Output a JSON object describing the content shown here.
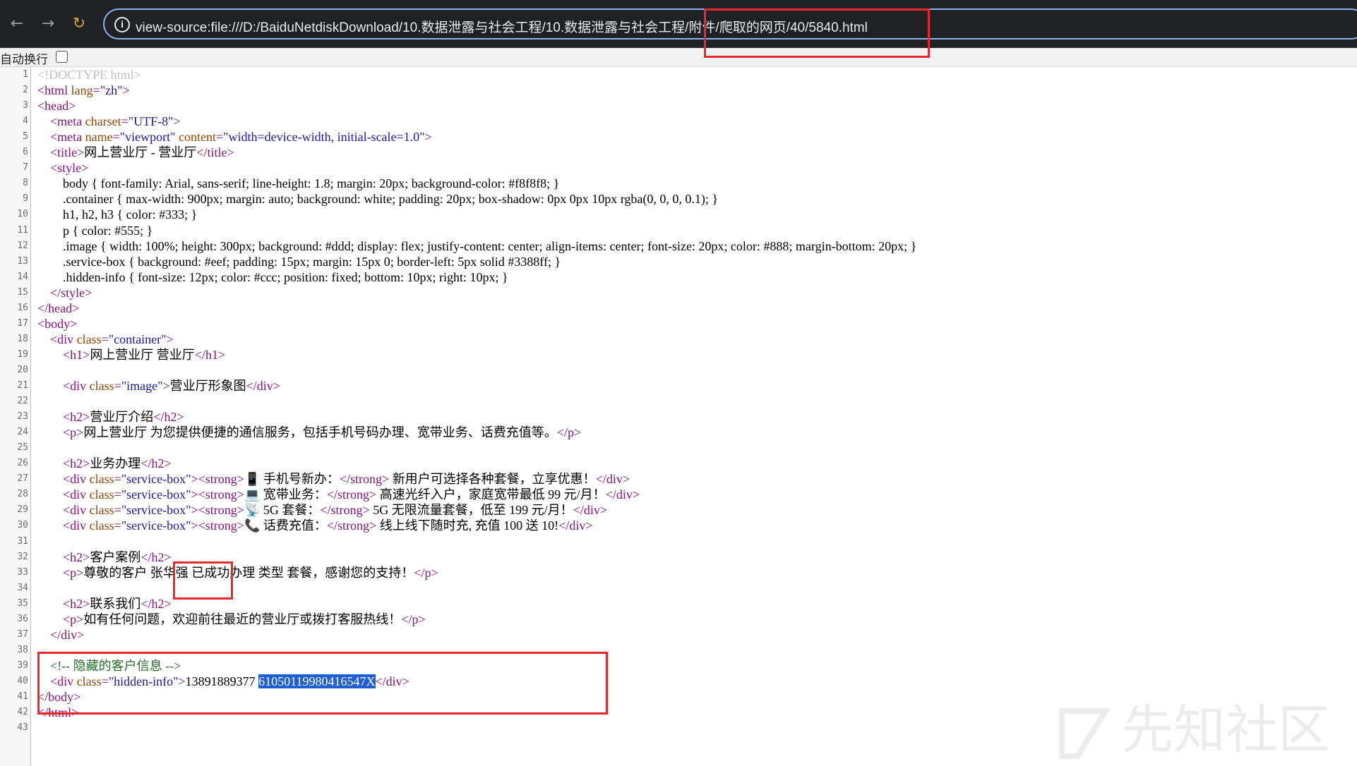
{
  "browser": {
    "back_icon": "←",
    "forward_icon": "→",
    "reload_icon": "↻",
    "info_icon": "i",
    "url": "view-source:file:///D:/BaiduNetdiskDownload/10.数据泄露与社会工程/10.数据泄露与社会工程/附件/爬取的网页/40/5840.html"
  },
  "view_source": {
    "wrap_label": "自动换行",
    "wrap_checked": false
  },
  "lines": [
    {
      "n": "1",
      "segs": [
        [
          "doc",
          "<!DOCTYPE html>"
        ]
      ]
    },
    {
      "n": "2",
      "segs": [
        [
          "tag",
          "<html "
        ],
        [
          "attr",
          "lang"
        ],
        [
          "tag",
          "="
        ],
        [
          "val",
          "\"zh\""
        ],
        [
          "tag",
          ">"
        ]
      ]
    },
    {
      "n": "3",
      "segs": [
        [
          "tag",
          "<head>"
        ]
      ]
    },
    {
      "n": "4",
      "segs": [
        [
          "plain",
          "    "
        ],
        [
          "tag",
          "<meta "
        ],
        [
          "attr",
          "charset"
        ],
        [
          "tag",
          "="
        ],
        [
          "val",
          "\"UTF-8\""
        ],
        [
          "tag",
          ">"
        ]
      ]
    },
    {
      "n": "5",
      "segs": [
        [
          "plain",
          "    "
        ],
        [
          "tag",
          "<meta "
        ],
        [
          "attr",
          "name"
        ],
        [
          "tag",
          "="
        ],
        [
          "val",
          "\"viewport\""
        ],
        [
          "tag",
          " "
        ],
        [
          "attr",
          "content"
        ],
        [
          "tag",
          "="
        ],
        [
          "val",
          "\"width=device-width, initial-scale=1.0\""
        ],
        [
          "tag",
          ">"
        ]
      ]
    },
    {
      "n": "6",
      "segs": [
        [
          "plain",
          "    "
        ],
        [
          "tag",
          "<title>"
        ],
        [
          "plain",
          "网上营业厅 - 营业厅"
        ],
        [
          "tag",
          "</title>"
        ]
      ]
    },
    {
      "n": "7",
      "segs": [
        [
          "plain",
          "    "
        ],
        [
          "tag",
          "<style>"
        ]
      ]
    },
    {
      "n": "8",
      "segs": [
        [
          "plain",
          "        body { font-family: Arial, sans-serif; line-height: 1.8; margin: 20px; background-color: #f8f8f8; }"
        ]
      ]
    },
    {
      "n": "9",
      "segs": [
        [
          "plain",
          "        .container { max-width: 900px; margin: auto; background: white; padding: 20px; box-shadow: 0px 0px 10px rgba(0, 0, 0, 0.1); }"
        ]
      ]
    },
    {
      "n": "10",
      "segs": [
        [
          "plain",
          "        h1, h2, h3 { color: #333; }"
        ]
      ]
    },
    {
      "n": "11",
      "segs": [
        [
          "plain",
          "        p { color: #555; }"
        ]
      ]
    },
    {
      "n": "12",
      "segs": [
        [
          "plain",
          "        .image { width: 100%; height: 300px; background: #ddd; display: flex; justify-content: center; align-items: center; font-size: 20px; color: #888; margin-bottom: 20px; }"
        ]
      ]
    },
    {
      "n": "13",
      "segs": [
        [
          "plain",
          "        .service-box { background: #eef; padding: 15px; margin: 15px 0; border-left: 5px solid #3388ff; }"
        ]
      ]
    },
    {
      "n": "14",
      "segs": [
        [
          "plain",
          "        .hidden-info { font-size: 12px; color: #ccc; position: fixed; bottom: 10px; right: 10px; }"
        ]
      ]
    },
    {
      "n": "15",
      "segs": [
        [
          "plain",
          "    "
        ],
        [
          "tag",
          "</style>"
        ]
      ]
    },
    {
      "n": "16",
      "segs": [
        [
          "tag",
          "</head>"
        ]
      ]
    },
    {
      "n": "17",
      "segs": [
        [
          "tag",
          "<body>"
        ]
      ]
    },
    {
      "n": "18",
      "segs": [
        [
          "plain",
          "    "
        ],
        [
          "tag",
          "<div "
        ],
        [
          "attr",
          "class"
        ],
        [
          "tag",
          "="
        ],
        [
          "val",
          "\"container\""
        ],
        [
          "tag",
          ">"
        ]
      ]
    },
    {
      "n": "19",
      "segs": [
        [
          "plain",
          "        "
        ],
        [
          "tag",
          "<h1>"
        ],
        [
          "plain",
          "网上营业厅 营业厅"
        ],
        [
          "tag",
          "</h1>"
        ]
      ]
    },
    {
      "n": "20",
      "segs": []
    },
    {
      "n": "21",
      "segs": [
        [
          "plain",
          "        "
        ],
        [
          "tag",
          "<div "
        ],
        [
          "attr",
          "class"
        ],
        [
          "tag",
          "="
        ],
        [
          "val",
          "\"image\""
        ],
        [
          "tag",
          ">"
        ],
        [
          "plain",
          "营业厅形象图"
        ],
        [
          "tag",
          "</div>"
        ]
      ]
    },
    {
      "n": "22",
      "segs": []
    },
    {
      "n": "23",
      "segs": [
        [
          "plain",
          "        "
        ],
        [
          "tag",
          "<h2>"
        ],
        [
          "plain",
          "营业厅介绍"
        ],
        [
          "tag",
          "</h2>"
        ]
      ]
    },
    {
      "n": "24",
      "segs": [
        [
          "plain",
          "        "
        ],
        [
          "tag",
          "<p>"
        ],
        [
          "plain",
          "网上营业厅 为您提供便捷的通信服务，包括手机号码办理、宽带业务、话费充值等。"
        ],
        [
          "tag",
          "</p>"
        ]
      ]
    },
    {
      "n": "25",
      "segs": []
    },
    {
      "n": "26",
      "segs": [
        [
          "plain",
          "        "
        ],
        [
          "tag",
          "<h2>"
        ],
        [
          "plain",
          "业务办理"
        ],
        [
          "tag",
          "</h2>"
        ]
      ]
    },
    {
      "n": "27",
      "segs": [
        [
          "plain",
          "        "
        ],
        [
          "tag",
          "<div "
        ],
        [
          "attr",
          "class"
        ],
        [
          "tag",
          "="
        ],
        [
          "val",
          "\"service-box\""
        ],
        [
          "tag",
          "><strong>"
        ],
        [
          "plain",
          "📱 手机号新办："
        ],
        [
          "tag",
          "</strong>"
        ],
        [
          "plain",
          " 新用户可选择各种套餐，立享优惠！"
        ],
        [
          "tag",
          "</div>"
        ]
      ]
    },
    {
      "n": "28",
      "segs": [
        [
          "plain",
          "        "
        ],
        [
          "tag",
          "<div "
        ],
        [
          "attr",
          "class"
        ],
        [
          "tag",
          "="
        ],
        [
          "val",
          "\"service-box\""
        ],
        [
          "tag",
          "><strong>"
        ],
        [
          "plain",
          "💻 宽带业务："
        ],
        [
          "tag",
          "</strong>"
        ],
        [
          "plain",
          " 高速光纤入户，家庭宽带最低 99 元/月！"
        ],
        [
          "tag",
          "</div>"
        ]
      ]
    },
    {
      "n": "29",
      "segs": [
        [
          "plain",
          "        "
        ],
        [
          "tag",
          "<div "
        ],
        [
          "attr",
          "class"
        ],
        [
          "tag",
          "="
        ],
        [
          "val",
          "\"service-box\""
        ],
        [
          "tag",
          "><strong>"
        ],
        [
          "plain",
          "📡 5G 套餐："
        ],
        [
          "tag",
          "</strong>"
        ],
        [
          "plain",
          " 5G 无限流量套餐，低至 199 元/月！"
        ],
        [
          "tag",
          "</div>"
        ]
      ]
    },
    {
      "n": "30",
      "segs": [
        [
          "plain",
          "        "
        ],
        [
          "tag",
          "<div "
        ],
        [
          "attr",
          "class"
        ],
        [
          "tag",
          "="
        ],
        [
          "val",
          "\"service-box\""
        ],
        [
          "tag",
          "><strong>"
        ],
        [
          "plain",
          "📞 话费充值："
        ],
        [
          "tag",
          "</strong>"
        ],
        [
          "plain",
          " 线上线下随时充, 充值 100 送 10!"
        ],
        [
          "tag",
          "</div>"
        ]
      ]
    },
    {
      "n": "31",
      "segs": []
    },
    {
      "n": "32",
      "segs": [
        [
          "plain",
          "        "
        ],
        [
          "tag",
          "<h2>"
        ],
        [
          "plain",
          "客户案例"
        ],
        [
          "tag",
          "</h2>"
        ]
      ]
    },
    {
      "n": "33",
      "segs": [
        [
          "plain",
          "        "
        ],
        [
          "tag",
          "<p>"
        ],
        [
          "plain",
          "尊敬的客户 张华强 已成功办理 类型 套餐，感谢您的支持！"
        ],
        [
          "tag",
          "</p>"
        ]
      ]
    },
    {
      "n": "34",
      "segs": []
    },
    {
      "n": "35",
      "segs": [
        [
          "plain",
          "        "
        ],
        [
          "tag",
          "<h2>"
        ],
        [
          "plain",
          "联系我们"
        ],
        [
          "tag",
          "</h2>"
        ]
      ]
    },
    {
      "n": "36",
      "segs": [
        [
          "plain",
          "        "
        ],
        [
          "tag",
          "<p>"
        ],
        [
          "plain",
          "如有任何问题，欢迎前往最近的营业厅或拨打客服热线！"
        ],
        [
          "tag",
          "</p>"
        ]
      ]
    },
    {
      "n": "37",
      "segs": [
        [
          "plain",
          "    "
        ],
        [
          "tag",
          "</div>"
        ]
      ]
    },
    {
      "n": "38",
      "segs": []
    },
    {
      "n": "39",
      "segs": [
        [
          "plain",
          "    "
        ],
        [
          "com",
          "<!-- 隐藏的客户信息 -->"
        ]
      ]
    },
    {
      "n": "40",
      "segs": [
        [
          "plain",
          "    "
        ],
        [
          "tag",
          "<div "
        ],
        [
          "attr",
          "class"
        ],
        [
          "tag",
          "="
        ],
        [
          "val",
          "\"hidden-info\""
        ],
        [
          "tag",
          ">"
        ],
        [
          "plain",
          "13891889377 "
        ],
        [
          "sel",
          "61050119980416547X"
        ],
        [
          "tag",
          "</div>"
        ]
      ]
    },
    {
      "n": "41",
      "segs": [
        [
          "tag",
          "</body>"
        ]
      ]
    },
    {
      "n": "42",
      "segs": [
        [
          "tag",
          "</html>"
        ]
      ]
    },
    {
      "n": "43",
      "segs": []
    }
  ],
  "watermark": "先知社区",
  "colors": {
    "annotation_red": "#e8282b",
    "selection_blue": "#1f5fd3",
    "omnibox_border": "#8ab4f8"
  }
}
